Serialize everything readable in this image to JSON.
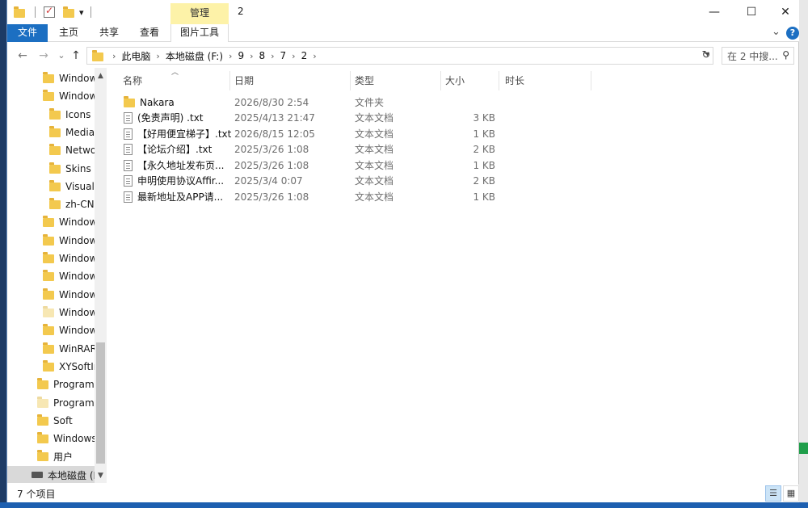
{
  "quick_access": {
    "dropdown": "▾"
  },
  "title": {
    "manage_tab": "管理",
    "window_title": "2",
    "minimize": "—",
    "maximize": "☐",
    "close": "✕"
  },
  "ribbon": {
    "tabs": [
      "文件",
      "主页",
      "共享",
      "查看",
      "图片工具"
    ],
    "expand": "⌄",
    "help": "?"
  },
  "nav": {
    "back": "←",
    "forward": "→",
    "recent": "⌄",
    "up": "↑",
    "breadcrumb": [
      "此电脑",
      "本地磁盘 (F:)",
      "9",
      "8",
      "7",
      "2"
    ],
    "search_placeholder": "在 2 中搜...",
    "refresh": "↻"
  },
  "navpane": {
    "items": [
      {
        "label": "Window",
        "icon": "folder-icon"
      },
      {
        "label": "Window",
        "icon": "folder-icon"
      },
      {
        "label": "Icons",
        "icon": "folder-icon"
      },
      {
        "label": "Media",
        "icon": "folder-icon"
      },
      {
        "label": "Netwo",
        "icon": "folder-icon"
      },
      {
        "label": "Skins",
        "icon": "folder-icon"
      },
      {
        "label": "Visualiz",
        "icon": "folder-icon"
      },
      {
        "label": "zh-CN",
        "icon": "folder-icon"
      },
      {
        "label": "Window",
        "icon": "folder-icon"
      },
      {
        "label": "Window",
        "icon": "folder-icon"
      },
      {
        "label": "Window",
        "icon": "folder-icon"
      },
      {
        "label": "Window",
        "icon": "folder-icon"
      },
      {
        "label": "Window",
        "icon": "folder-icon"
      },
      {
        "label": "Window",
        "icon": "folder-icon"
      },
      {
        "label": "Window",
        "icon": "folder-icon"
      },
      {
        "label": "WinRAR",
        "icon": "folder-icon"
      },
      {
        "label": "XYSoftIr",
        "icon": "folder-icon"
      },
      {
        "label": "Program",
        "icon": "folder-icon"
      },
      {
        "label": "ProgramD",
        "icon": "folder-icon"
      },
      {
        "label": "Soft",
        "icon": "folder-icon"
      },
      {
        "label": "Windows",
        "icon": "folder-icon"
      },
      {
        "label": "用户",
        "icon": "folder-icon"
      },
      {
        "label": "本地磁盘 (F",
        "icon": "drive-icon"
      }
    ]
  },
  "columns": {
    "name": "名称",
    "date": "日期",
    "type": "类型",
    "size": "大小",
    "duration": "时长"
  },
  "files": [
    {
      "name": "Nakara",
      "date": "2026/8/30 2:54",
      "type": "文件夹",
      "size": "",
      "icon": "folder-icon"
    },
    {
      "name": "(免责声明) .txt",
      "date": "2025/4/13 21:47",
      "type": "文本文档",
      "size": "3 KB",
      "icon": "text-file-icon"
    },
    {
      "name": "【好用便宜梯子】.txt",
      "date": "2026/8/15 12:05",
      "type": "文本文档",
      "size": "1 KB",
      "icon": "text-file-icon"
    },
    {
      "name": "【论坛介绍】.txt",
      "date": "2025/3/26 1:08",
      "type": "文本文档",
      "size": "2 KB",
      "icon": "text-file-icon"
    },
    {
      "name": "【永久地址发布页...",
      "date": "2025/3/26 1:08",
      "type": "文本文档",
      "size": "1 KB",
      "icon": "text-file-icon"
    },
    {
      "name": "申明使用协议Affir...",
      "date": "2025/3/4 0:07",
      "type": "文本文档",
      "size": "2 KB",
      "icon": "text-file-icon"
    },
    {
      "name": "最新地址及APP请...",
      "date": "2025/3/26 1:08",
      "type": "文本文档",
      "size": "1 KB",
      "icon": "text-file-icon"
    }
  ],
  "status": {
    "count": "7 个项目"
  }
}
